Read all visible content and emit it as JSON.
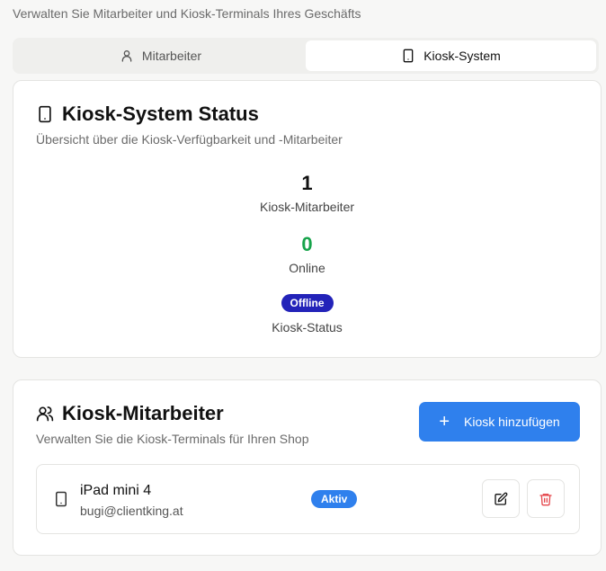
{
  "header": {
    "subtitle": "Verwalten Sie Mitarbeiter und Kiosk-Terminals Ihres Geschäfts"
  },
  "tabs": [
    {
      "label": "Mitarbeiter",
      "icon": "user-icon",
      "active": false
    },
    {
      "label": "Kiosk-System",
      "icon": "tablet-icon",
      "active": true
    }
  ],
  "status_card": {
    "title": "Kiosk-System Status",
    "subtitle": "Übersicht über die Kiosk-Verfügbarkeit und -Mitarbeiter",
    "kiosk_staff_count": "1",
    "kiosk_staff_label": "Kiosk-Mitarbeiter",
    "online_count": "0",
    "online_label": "Online",
    "status_badge": "Offline",
    "status_label": "Kiosk-Status"
  },
  "staff_card": {
    "title": "Kiosk-Mitarbeiter",
    "subtitle": "Verwalten Sie die Kiosk-Terminals für Ihren Shop",
    "add_button": "Kiosk hinzufügen",
    "kiosks": [
      {
        "name": "iPad mini 4",
        "email": "bugi@clientking.at",
        "status": "Aktiv"
      }
    ]
  },
  "colors": {
    "accent": "#2f80ed",
    "offline_badge": "#2323b9",
    "online_count": "#16a34a",
    "delete": "#e5484d"
  }
}
